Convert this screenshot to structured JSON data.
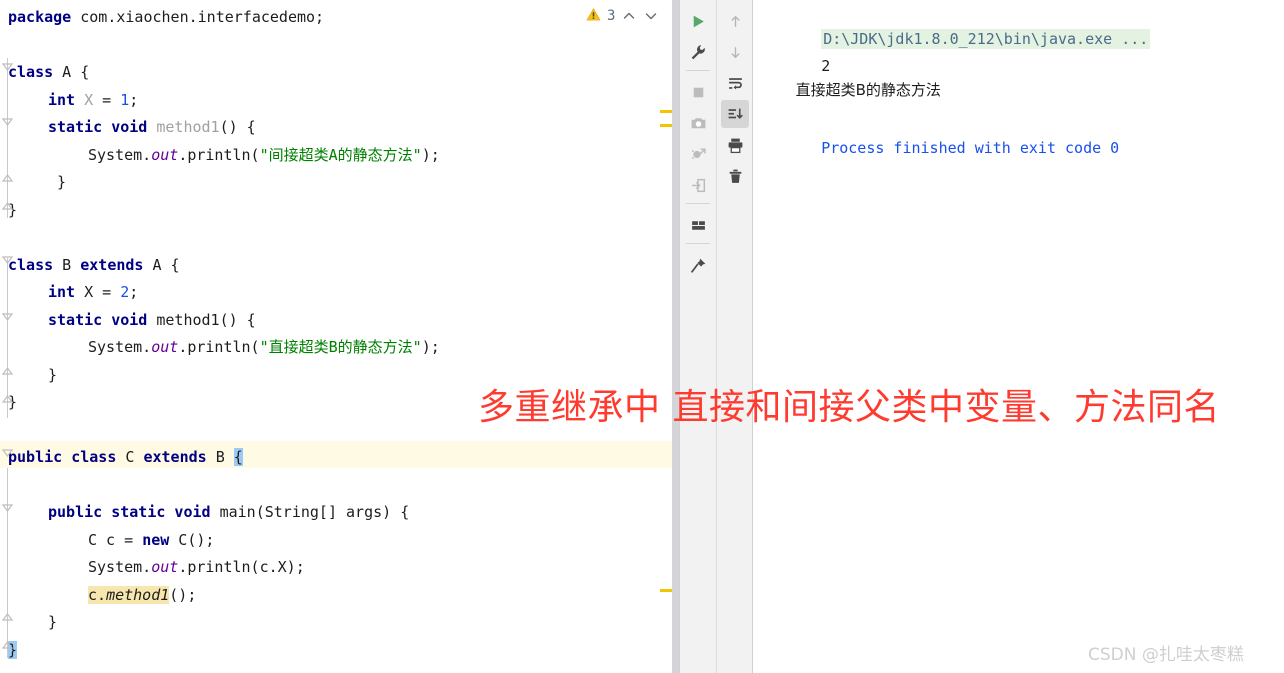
{
  "editor": {
    "warning_count": "3",
    "icons": {
      "warning": "warning-triangle-icon",
      "prev": "chevron-up-icon",
      "next": "chevron-down-icon"
    },
    "lines": [
      {
        "n": 1,
        "indent": 0,
        "tokens": [
          {
            "t": "package",
            "c": "kw"
          },
          {
            "t": " com.xiaochen.interfacedemo;",
            "c": "plain"
          }
        ]
      },
      {
        "n": 2,
        "indent": 0,
        "tokens": []
      },
      {
        "n": 3,
        "indent": 0,
        "tokens": [
          {
            "t": "class",
            "c": "kw"
          },
          {
            "t": " A {",
            "c": "plain"
          }
        ]
      },
      {
        "n": 4,
        "indent": 1,
        "tokens": [
          {
            "t": "int",
            "c": "kw"
          },
          {
            "t": " ",
            "c": "plain"
          },
          {
            "t": "X",
            "c": "grey"
          },
          {
            "t": " = ",
            "c": "plain"
          },
          {
            "t": "1",
            "c": "num"
          },
          {
            "t": ";",
            "c": "plain"
          }
        ]
      },
      {
        "n": 5,
        "indent": 1,
        "tokens": [
          {
            "t": "static void",
            "c": "kw"
          },
          {
            "t": " ",
            "c": "plain"
          },
          {
            "t": "method1",
            "c": "grey"
          },
          {
            "t": "() {",
            "c": "plain"
          }
        ]
      },
      {
        "n": 6,
        "indent": 2,
        "tokens": [
          {
            "t": "System.",
            "c": "plain"
          },
          {
            "t": "out",
            "c": "field"
          },
          {
            "t": ".println(",
            "c": "plain"
          },
          {
            "t": "\"间接超类A的静态方法\"",
            "c": "str"
          },
          {
            "t": ");",
            "c": "plain"
          }
        ]
      },
      {
        "n": 7,
        "indent": 1,
        "tokens": [
          {
            "t": " }",
            "c": "plain"
          }
        ]
      },
      {
        "n": 8,
        "indent": 0,
        "tokens": [
          {
            "t": "}",
            "c": "plain"
          }
        ]
      },
      {
        "n": 9,
        "indent": 0,
        "tokens": []
      },
      {
        "n": 10,
        "indent": 0,
        "tokens": [
          {
            "t": "class",
            "c": "kw"
          },
          {
            "t": " B ",
            "c": "plain"
          },
          {
            "t": "extends",
            "c": "kw"
          },
          {
            "t": " A {",
            "c": "plain"
          }
        ]
      },
      {
        "n": 11,
        "indent": 1,
        "tokens": [
          {
            "t": "int",
            "c": "kw"
          },
          {
            "t": " ",
            "c": "plain"
          },
          {
            "t": "X",
            "c": "plain"
          },
          {
            "t": " = ",
            "c": "plain"
          },
          {
            "t": "2",
            "c": "num"
          },
          {
            "t": ";",
            "c": "plain"
          }
        ]
      },
      {
        "n": 12,
        "indent": 1,
        "tokens": [
          {
            "t": "static void",
            "c": "kw"
          },
          {
            "t": " method1() {",
            "c": "plain"
          }
        ]
      },
      {
        "n": 13,
        "indent": 2,
        "tokens": [
          {
            "t": "System.",
            "c": "plain"
          },
          {
            "t": "out",
            "c": "field"
          },
          {
            "t": ".println(",
            "c": "plain"
          },
          {
            "t": "\"直接超类B的静态方法\"",
            "c": "str"
          },
          {
            "t": ");",
            "c": "plain"
          }
        ]
      },
      {
        "n": 14,
        "indent": 1,
        "tokens": [
          {
            "t": "}",
            "c": "plain"
          }
        ]
      },
      {
        "n": 15,
        "indent": 0,
        "tokens": [
          {
            "t": "}",
            "c": "plain"
          }
        ]
      },
      {
        "n": 16,
        "indent": 0,
        "tokens": []
      },
      {
        "n": 17,
        "indent": 0,
        "tokens": [
          {
            "t": "public class",
            "c": "kw"
          },
          {
            "t": " C ",
            "c": "plain"
          },
          {
            "t": "extends",
            "c": "kw"
          },
          {
            "t": " B ",
            "c": "plain"
          },
          {
            "t": "{",
            "c": "plain brace-hl"
          }
        ]
      },
      {
        "n": 18,
        "indent": 0,
        "tokens": []
      },
      {
        "n": 19,
        "indent": 1,
        "tokens": [
          {
            "t": "public static void",
            "c": "kw"
          },
          {
            "t": " main(String[] args) {",
            "c": "plain"
          }
        ]
      },
      {
        "n": 20,
        "indent": 2,
        "tokens": [
          {
            "t": "C c = ",
            "c": "plain"
          },
          {
            "t": "new",
            "c": "kw"
          },
          {
            "t": " C();",
            "c": "plain"
          }
        ]
      },
      {
        "n": 21,
        "indent": 2,
        "tokens": [
          {
            "t": "System.",
            "c": "plain"
          },
          {
            "t": "out",
            "c": "field"
          },
          {
            "t": ".println(c.X);",
            "c": "plain"
          }
        ]
      },
      {
        "n": 22,
        "indent": 2,
        "tokens": [
          {
            "t": "c.",
            "c": "plain ident-hl"
          },
          {
            "t": "method1",
            "c": "mth ident-hl"
          },
          {
            "t": "();",
            "c": "plain"
          }
        ]
      },
      {
        "n": 23,
        "indent": 1,
        "tokens": [
          {
            "t": "}",
            "c": "plain"
          }
        ]
      },
      {
        "n": 24,
        "indent": 0,
        "tokens": [
          {
            "t": "}",
            "c": "plain brace-hl"
          }
        ]
      }
    ],
    "warning_markers": [
      110,
      124,
      589
    ],
    "caret_line_index": 16
  },
  "toolbar": {
    "left": [
      {
        "name": "run-icon",
        "label": "Rerun",
        "state": "enabled"
      },
      {
        "name": "wrench-icon",
        "label": "Edit Configuration",
        "state": "enabled"
      },
      {
        "name": "separator",
        "label": "",
        "state": "sep"
      },
      {
        "name": "stop-icon",
        "label": "Stop",
        "state": "disabled"
      },
      {
        "name": "camera-icon",
        "label": "Screenshot",
        "state": "disabled"
      },
      {
        "name": "debug-restore-icon",
        "label": "Restore Layout",
        "state": "disabled"
      },
      {
        "name": "import-arrow-icon",
        "label": "Import",
        "state": "disabled"
      },
      {
        "name": "separator",
        "label": "",
        "state": "sep"
      },
      {
        "name": "layout-icon",
        "label": "Layout Settings",
        "state": "enabled"
      },
      {
        "name": "separator",
        "label": "",
        "state": "sep"
      },
      {
        "name": "pin-icon",
        "label": "Pin Tab",
        "state": "enabled"
      }
    ],
    "right": [
      {
        "name": "arrow-up-icon",
        "label": "Up the Stack Trace",
        "state": "disabled"
      },
      {
        "name": "arrow-down-icon",
        "label": "Down the Stack Trace",
        "state": "disabled"
      },
      {
        "name": "soft-wrap-icon",
        "label": "Use Soft Wraps",
        "state": "enabled"
      },
      {
        "name": "scroll-to-end-icon",
        "label": "Scroll to End",
        "state": "active"
      },
      {
        "name": "print-icon",
        "label": "Print",
        "state": "enabled"
      },
      {
        "name": "trash-icon",
        "label": "Clear All",
        "state": "enabled"
      }
    ]
  },
  "console": {
    "command": "D:\\JDK\\jdk1.8.0_212\\bin\\java.exe ...",
    "output": [
      "2",
      "直接超类B的静态方法"
    ],
    "status": "Process finished with exit code 0"
  },
  "annotation": {
    "text": "多重继承中 直接和间接父类中变量、方法同名",
    "color": "#ff3b30"
  },
  "watermark": {
    "text": "CSDN @扎哇太枣糕"
  },
  "colors": {
    "keyword": "#000082",
    "string": "#008000",
    "number": "#1750eb",
    "field": "#660099",
    "unused": "#a0a0a0",
    "caret_line": "#fffae3",
    "brace_match": "#9bcbf5",
    "identifier_highlight": "#f7e7ae",
    "warning_marker": "#f2c500",
    "console_command_bg": "#e3f2e1",
    "console_status": "#1750eb",
    "annotation": "#ff3b30",
    "toolbar_bg": "#f2f2f2"
  }
}
